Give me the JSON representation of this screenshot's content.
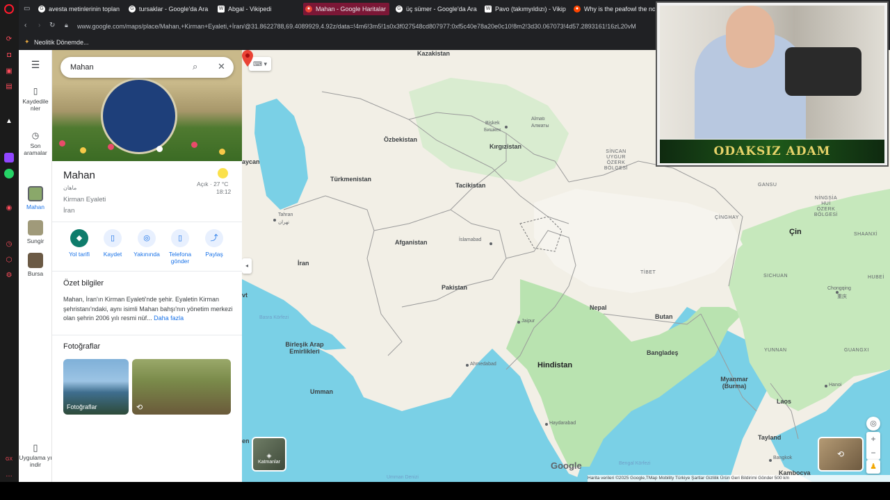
{
  "tabs": [
    {
      "label": "avesta metinlerinin toplan",
      "icon": "google-icon"
    },
    {
      "label": "tursaklar - Google'da Ara",
      "icon": "google-icon"
    },
    {
      "label": "Abgal - Vikipedi",
      "icon": "wikipedia-icon"
    },
    {
      "label": "Mahan - Google Haritalar",
      "icon": "maps-icon"
    },
    {
      "label": "üç sümer - Google'da Ara",
      "icon": "google-icon"
    },
    {
      "label": "Pavo (takımyıldızı) - Vikip",
      "icon": "wikipedia-icon"
    },
    {
      "label": "Why is the peafowl the no",
      "icon": "reddit-icon"
    }
  ],
  "address": {
    "url": "www.google.com/maps/place/Mahan,+Kirman+Eyaleti,+İran/@31.8622788,69.4089929,4.92z/data=!4m6!3m5!1s0x3f027548cd807977:0xf5c40e78a20e0c10!8m2!3d30.067073!4d57.2893161!16zL20vM"
  },
  "bookmarks": {
    "item": "Neolitik Dönemde..."
  },
  "rail": {
    "saved": "Kaydedile nler",
    "recent": "Son aramalar",
    "place1": "Mahan",
    "place2": "Sungir",
    "place3": "Bursa",
    "app": "Uygulama yı indir"
  },
  "search": {
    "value": "Mahan"
  },
  "place": {
    "name": "Mahan",
    "native": "ماهان",
    "region": "Kirman Eyaleti",
    "country": "İran",
    "weather": "Açık · 27 °C",
    "time": "18:12"
  },
  "actions": [
    "Yol tarifi",
    "Kaydet",
    "Yakınında",
    "Telefona gönder",
    "Paylaş"
  ],
  "summary": {
    "heading": "Özet bilgiler",
    "text": "Mahan, İran'ın Kirman Eyaleti'nde şehir. Eyaletin Kirman şehristanı'ndaki, aynı isimli Mahan bahşı'nın yönetim merkezi olan şehrin 2006 yılı resmi nüf...",
    "more": "Daha fazla"
  },
  "photos": {
    "heading": "Fotoğraflar",
    "label": "Fotoğraflar"
  },
  "map": {
    "countries": [
      "Kazakistan",
      "Özbekistan",
      "Kırgızistan",
      "Türkmenistan",
      "Tacikistan",
      "Afganistan",
      "İran",
      "Pakistan",
      "Nepal",
      "Butan",
      "Bangladeş",
      "Hindistan",
      "Myanmar (Burma)",
      "Laos",
      "Tayland",
      "Kambocya",
      "Umman",
      "Birleşik Arap Emirlikleri",
      "Çin"
    ],
    "cities": [
      "Bişkek",
      "Бишкек",
      "Almatı",
      "Алматы",
      "Tahran",
      "تهران",
      "İslamabad",
      "Jaipur",
      "Ahmedabad",
      "Haydarabad",
      "Chongqing",
      "重庆",
      "Hanoi",
      "Bangkok"
    ],
    "regions": [
      "SİNCAN UYGUR ÖZERK BÖLGESİ",
      "TİBET",
      "ÇİNGHAY",
      "GANSU",
      "NİNGSİA HUİ ÖZERK BÖLGESİ",
      "SICHUAN",
      "YUNNAN",
      "GUANGXI",
      "SHAANXİ",
      "HUBEİ"
    ],
    "seas": [
      "Basra Körfezi",
      "Bengal Körfezi",
      "Umman Denizi"
    ],
    "edge": [
      "aycan",
      "en",
      "vt"
    ],
    "layers": "Katmanlar",
    "google": "Google",
    "footer": "Harita verileri ©2025 Google,TMap Mobility   Türkiye   Şartlar   Gizlilik   Ürün Geri Bildirimi Gönder   500 km"
  },
  "overlay": {
    "banner": "ODAKSIZ ADAM"
  }
}
